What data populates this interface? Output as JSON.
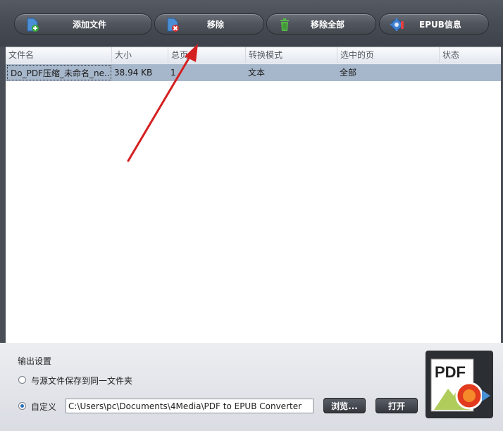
{
  "toolbar": {
    "add_file": "添加文件",
    "remove": "移除",
    "remove_all": "移除全部",
    "epub_info": "EPUB信息"
  },
  "table": {
    "columns": [
      "文件名",
      "大小",
      "总页",
      "转换模式",
      "选中的页",
      "状态"
    ],
    "rows": [
      [
        "Do_PDF压缩_未命名_ne...",
        "38.94 KB",
        "1",
        "文本",
        "全部",
        ""
      ]
    ]
  },
  "output": {
    "title": "输出设置",
    "option_same_folder": "与源文件保存到同一文件夹",
    "option_custom": "自定义",
    "path_value": "C:\\Users\\pc\\Documents\\4Media\\PDF to EPUB Converter",
    "browse": "浏览...",
    "open": "打开"
  },
  "logo": {
    "text": "PDF"
  },
  "colors": {
    "selected_row": "#a7b7cb",
    "toolbar": "#4a4e56",
    "arrow": "#d42020"
  }
}
